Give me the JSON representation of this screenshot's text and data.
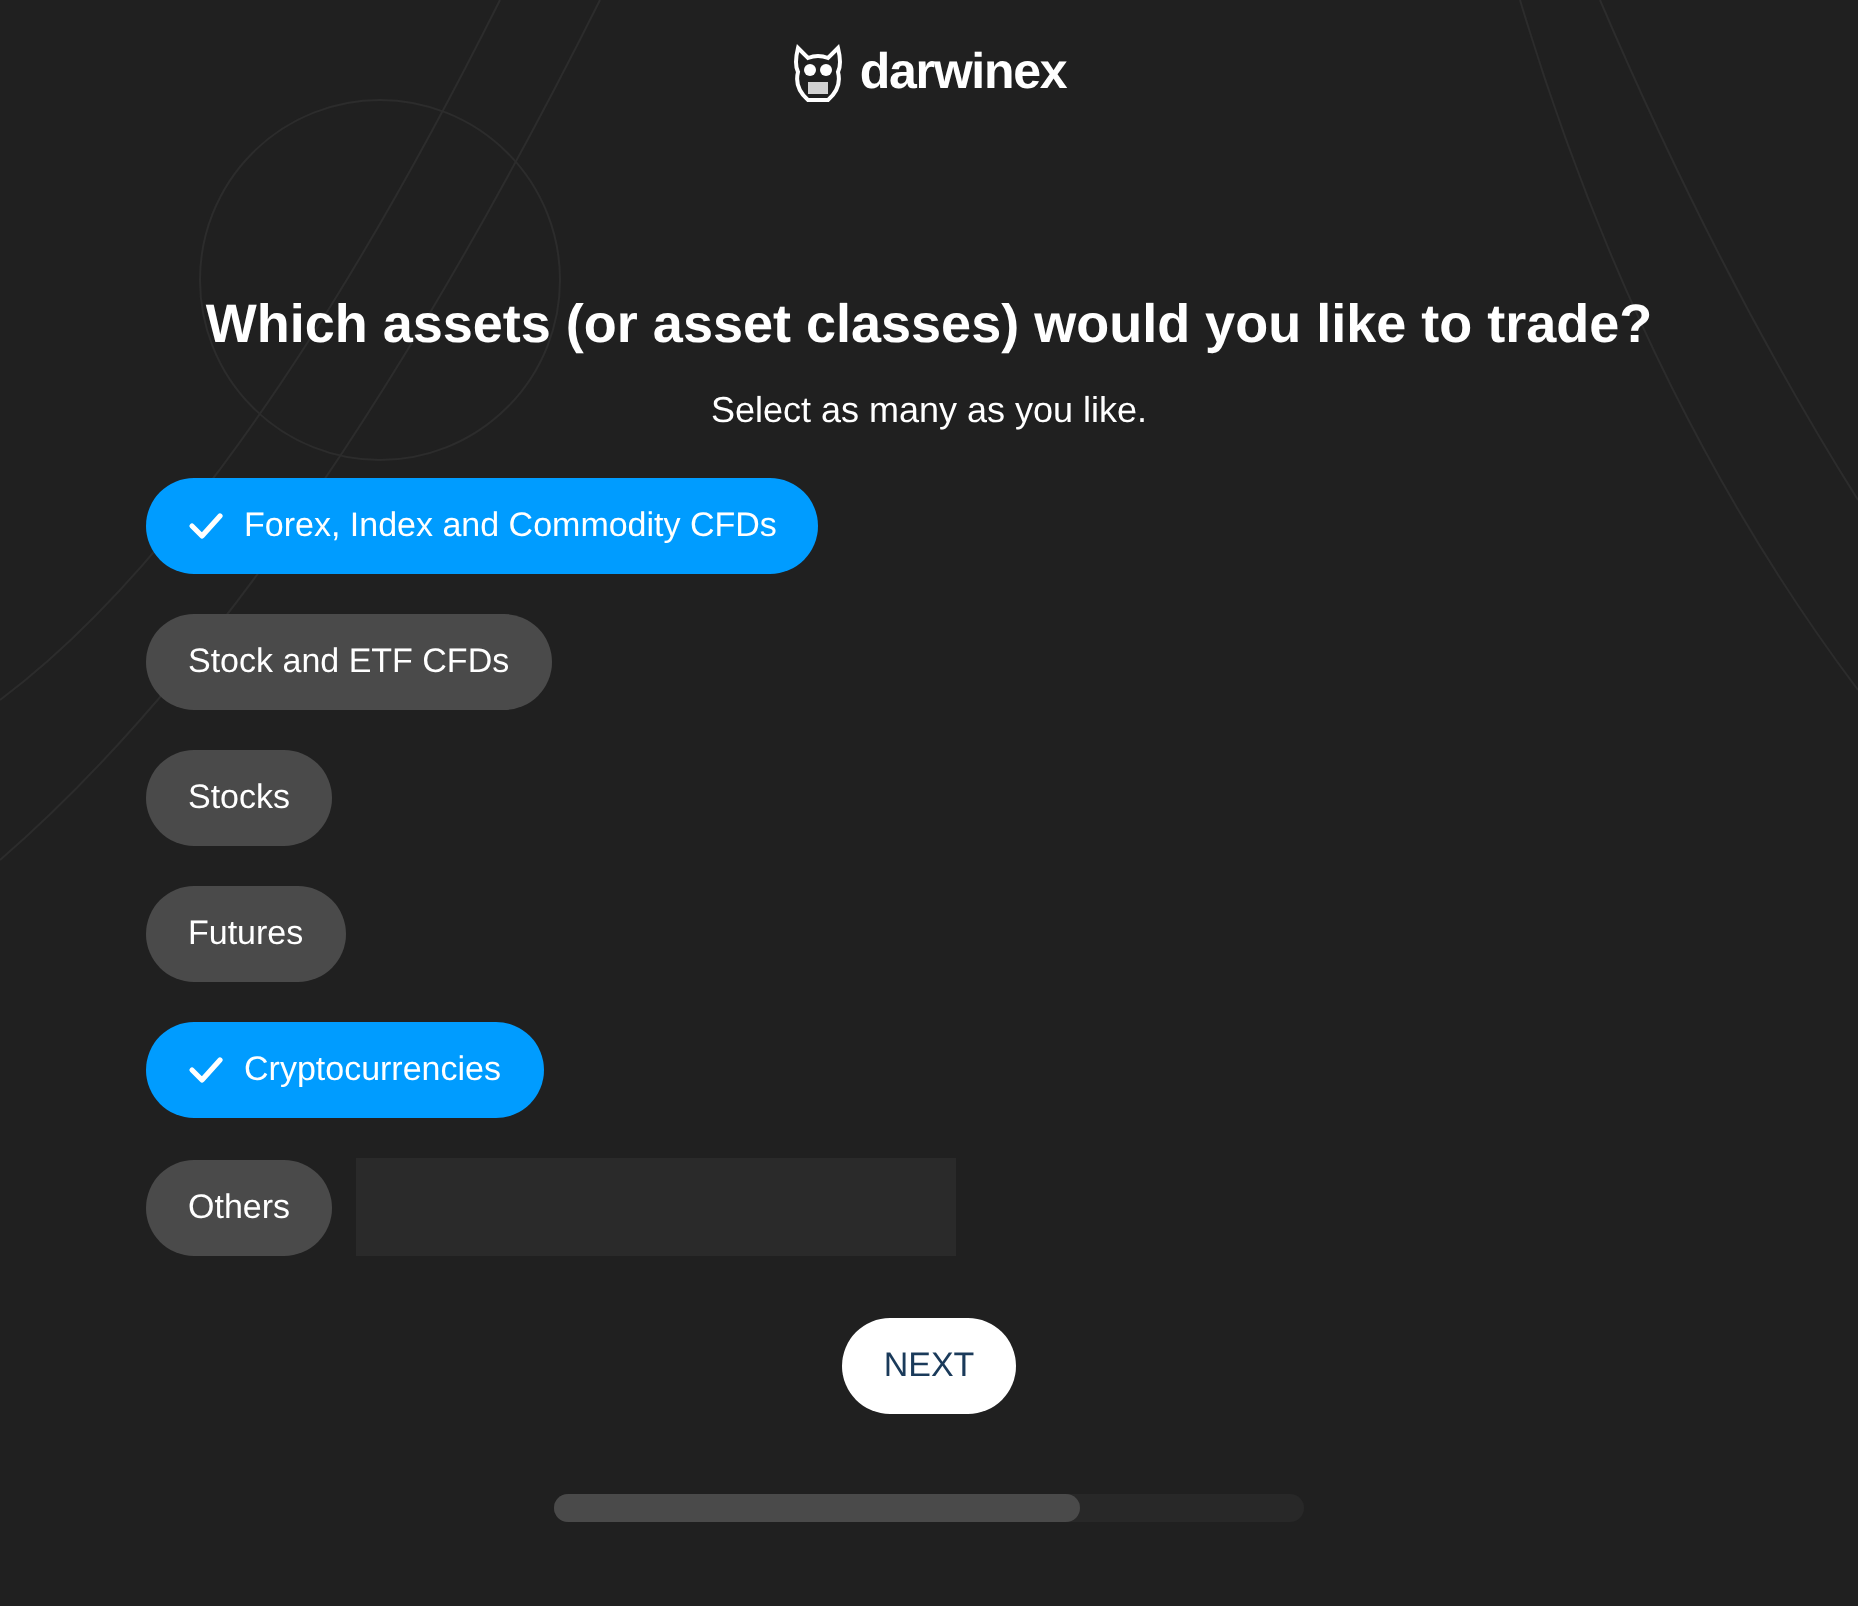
{
  "logo": {
    "text": "darwinex"
  },
  "heading": "Which assets (or asset classes) would you like to trade?",
  "subtitle": "Select as many as you like.",
  "options": [
    {
      "label": "Forex, Index and Commodity CFDs",
      "selected": true
    },
    {
      "label": "Stock and ETF CFDs",
      "selected": false
    },
    {
      "label": "Stocks",
      "selected": false
    },
    {
      "label": "Futures",
      "selected": false
    },
    {
      "label": "Cryptocurrencies",
      "selected": true
    },
    {
      "label": "Others",
      "selected": false,
      "kind": "with-input"
    }
  ],
  "next_button": "NEXT",
  "progress": {
    "level": 0.7
  }
}
